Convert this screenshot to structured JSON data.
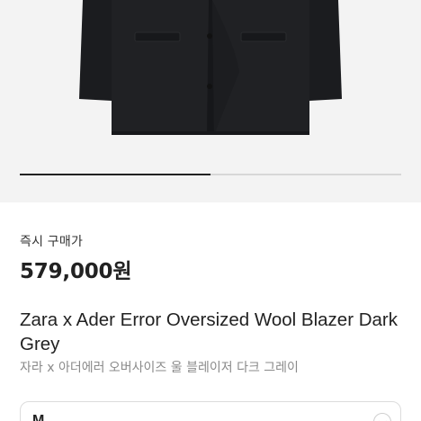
{
  "product": {
    "image_alt_icon": "blazer-image",
    "gallery": {
      "current_index": 1,
      "total": 2
    },
    "price_label": "즉시 구매가",
    "price": "579,000원",
    "title": "Zara x Ader Error Oversized Wool Blazer Dark Grey",
    "subtitle": "자라 x 아더에러 오버사이즈 울 블레이저 다크 그레이"
  },
  "size_select": {
    "value": "M",
    "icon": "chevron-down-icon"
  },
  "colors": {
    "garment": "#1e1f22",
    "background": "#f3f3f3",
    "accent_text": "#222222",
    "muted_text": "#8a8a8a"
  }
}
